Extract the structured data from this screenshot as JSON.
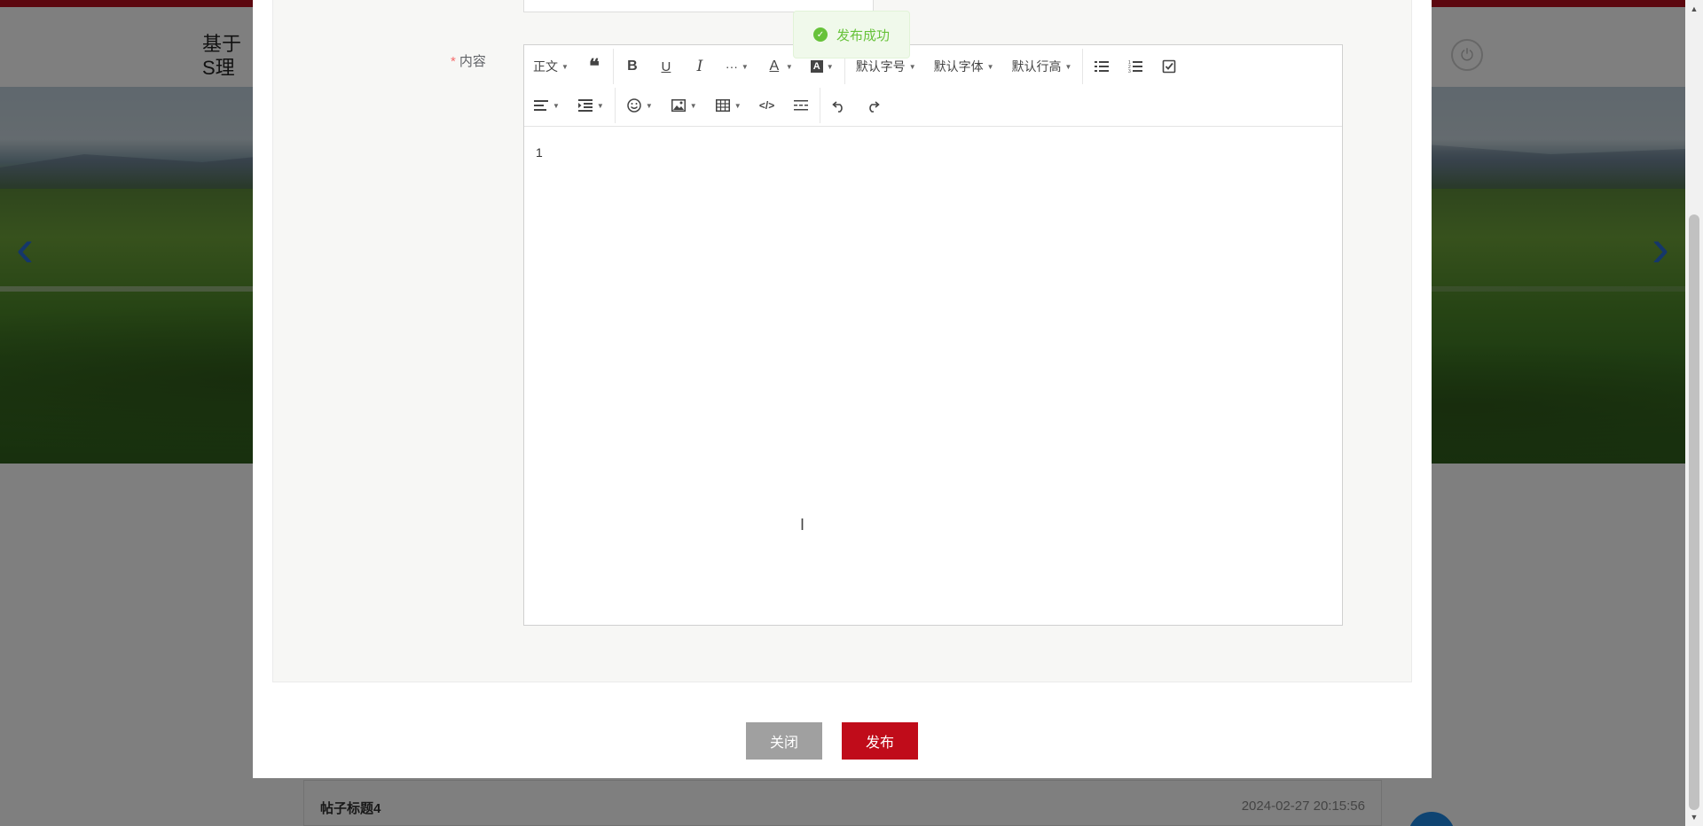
{
  "site": {
    "title": "基于S理系统"
  },
  "toast": {
    "message": "发布成功"
  },
  "form": {
    "content_label": "内容",
    "required_mark": "*",
    "editor_text": "1"
  },
  "toolbar": {
    "paragraph_label": "正文",
    "font_size_label": "默认字号",
    "font_family_label": "默认字体",
    "line_height_label": "默认行高",
    "more_label": "···"
  },
  "buttons": {
    "close": "关闭",
    "publish": "发布"
  },
  "background_list": {
    "post_title": "帖子标题4",
    "post_time": "2024-02-27 20:15:56"
  },
  "icons": [
    "quote-icon",
    "bold-icon",
    "underline-icon",
    "italic-icon",
    "font-color-icon",
    "background-color-icon",
    "bulleted-list-icon",
    "numbered-list-icon",
    "todo-icon",
    "align-icon",
    "indent-icon",
    "emoji-icon",
    "image-icon",
    "table-icon",
    "code-icon",
    "divider-icon",
    "undo-icon",
    "redo-icon",
    "success-icon",
    "power-icon"
  ],
  "colors": {
    "accent": "#c00c1a",
    "success": "#67c23a",
    "close_button": "#a0a0a0"
  }
}
